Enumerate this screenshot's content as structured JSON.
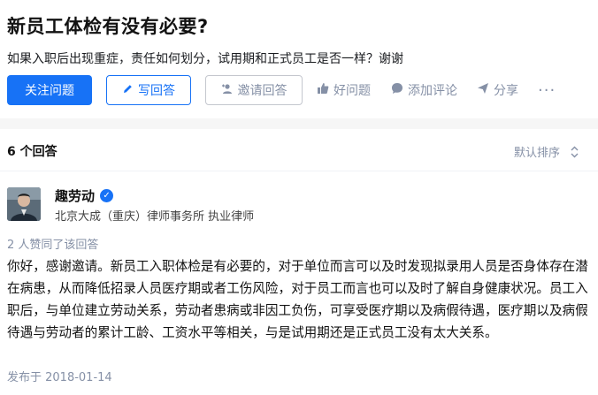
{
  "question": {
    "title": "新员工体检有没有必要?",
    "detail": "如果入职后出现重症，责任如何划分，试用期和正式员工是否一样？谢谢"
  },
  "actions": {
    "follow": "关注问题",
    "write": "写回答",
    "invite": "邀请回答",
    "good": "好问题",
    "comment": "添加评论",
    "share": "分享",
    "more": "···"
  },
  "answers": {
    "count": "6 个回答",
    "sort": "默认排序"
  },
  "answer": {
    "author": "趣劳动",
    "bio": "北京大成（重庆）律师事务所 执业律师",
    "voters": "2 人赞同了该回答",
    "content": "你好，感谢邀请。新员工入职体检是有必要的，对于单位而言可以及时发现拟录用人员是否身体存在潜在病患，从而降低招录人员医疗期或者工伤风险，对于员工而言也可以及时了解自身健康状况。员工入职后，与单位建立劳动关系，劳动者患病或非因工负伤，可享受医疗期以及病假待遇，医疗期以及病假待遇与劳动者的累计工龄、工资水平等相关，与是试用期还是正式员工没有太大关系。",
    "published": "发布于 2018-01-14"
  },
  "colors": {
    "accent": "#1772f6",
    "muted": "#8590a6"
  }
}
